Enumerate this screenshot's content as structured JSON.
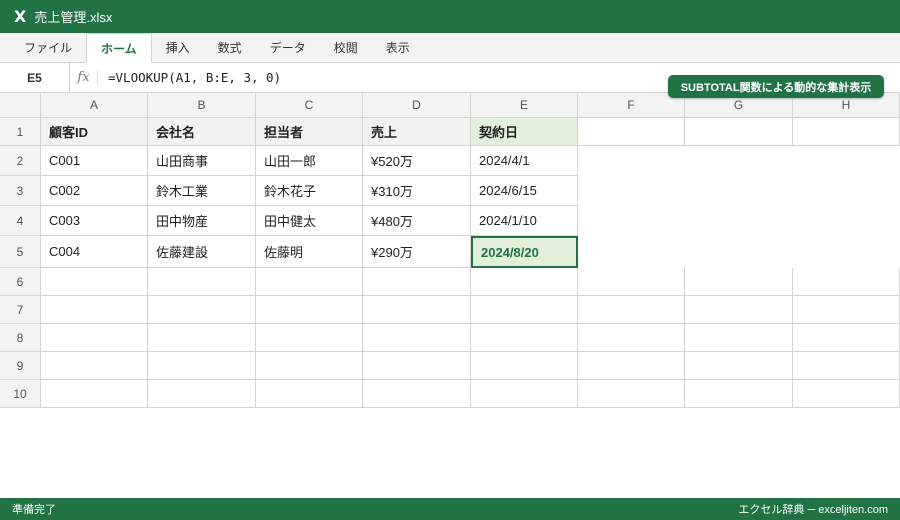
{
  "window": {
    "icon_letter": "X",
    "title": "売上管理.xlsx"
  },
  "ribbon": {
    "tabs": [
      "ファイル",
      "ホーム",
      "挿入",
      "数式",
      "データ",
      "校閲",
      "表示"
    ],
    "active": "ホーム"
  },
  "formula_bar": {
    "name_box": "E5",
    "fx": "fx",
    "formula": "=VLOOKUP(A1, B:E, 3, 0)"
  },
  "banner": "SUBTOTAL関数による動的な集計表示",
  "sheet": {
    "columns": [
      "A",
      "B",
      "C",
      "D",
      "E",
      "F",
      "G",
      "H"
    ],
    "rows": [
      [
        "顧客ID",
        "会社名",
        "担当者",
        "売上",
        "契約日"
      ],
      [
        "C001",
        "山田商事",
        "山田一郎",
        "¥520万",
        "2024/4/1"
      ],
      [
        "C002",
        "鈴木工業",
        "鈴木花子",
        "¥310万",
        "2024/6/15"
      ],
      [
        "C003",
        "田中物産",
        "田中健太",
        "¥480万",
        "2024/1/10"
      ],
      [
        "C004",
        "佐藤建設",
        "佐藤明",
        "¥290万",
        "2024/8/20"
      ]
    ],
    "row_numbers": [
      "1",
      "2",
      "3",
      "4",
      "5",
      "6",
      "7",
      "8",
      "9",
      "10"
    ]
  },
  "status": {
    "left": "準備完了",
    "right": "エクセル辞典 ─ exceljiten.com"
  },
  "colors": {
    "accent": "#217346",
    "header_fill": "#f2f2f2",
    "selected_fill": "#e2efda"
  }
}
